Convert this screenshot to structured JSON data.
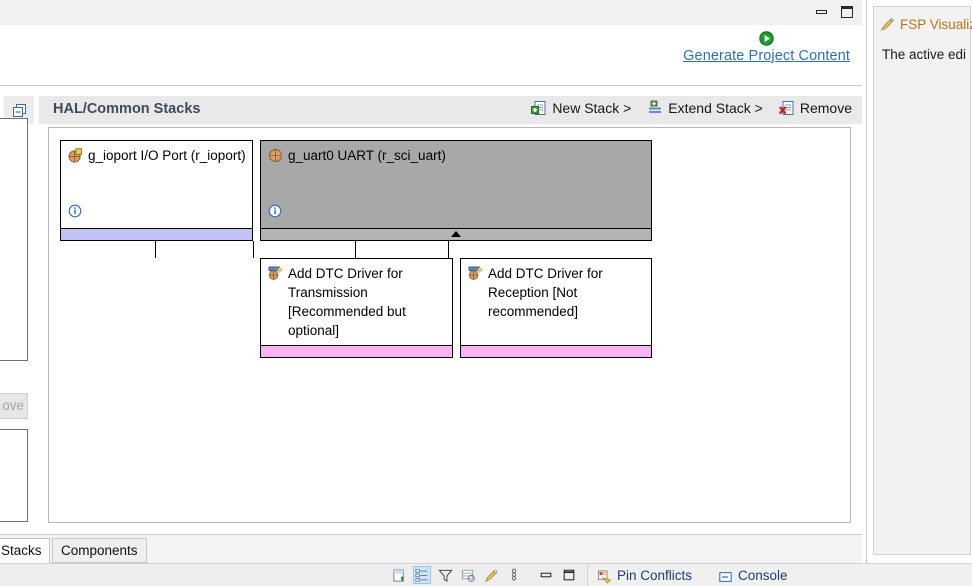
{
  "editor": {
    "window_controls": {
      "minimize": "minimize",
      "maximize": "maximize"
    },
    "generate": {
      "link_label": "Generate Project Content",
      "icon": "green-play-icon",
      "link_color": "#2f6fb8"
    },
    "section": {
      "title": "HAL/Common Stacks",
      "collapse_icon": "collapse-icon",
      "actions": [
        {
          "label": "New Stack >",
          "icon": "new-stack-icon"
        },
        {
          "label": "Extend Stack >",
          "icon": "extend-stack-icon"
        },
        {
          "label": "Remove",
          "icon": "remove-icon"
        }
      ]
    },
    "tabs": [
      {
        "label": "Stacks",
        "active": true
      },
      {
        "label": "Components",
        "active": false
      }
    ]
  },
  "diagram": {
    "nodes": [
      {
        "id": "ioport",
        "title": "g_ioport I/O Port (r_ioport)",
        "icon": "module-icon",
        "info_icon": "info-icon",
        "footer_color": "#c2c2f5",
        "selected": false
      },
      {
        "id": "uart",
        "title": "g_uart0 UART (r_sci_uart)",
        "icon": "module-icon",
        "info_icon": "info-icon",
        "footer_color": "#b4b4b4",
        "selected": true,
        "expander": "triangle-up-icon"
      },
      {
        "id": "dtc-tx",
        "title": "Add DTC Driver for Transmission [Recommended but optional]",
        "icon": "add-module-icon",
        "footer_color": "#f7b3f2",
        "selected": false
      },
      {
        "id": "dtc-rx",
        "title": "Add DTC Driver for Reception [Not recommended]",
        "icon": "add-module-icon",
        "footer_color": "#f7b3f2",
        "selected": false
      }
    ]
  },
  "left_peek": {
    "collapse_icon": "collapse-icon",
    "remove_button_label": "ove"
  },
  "right_panel": {
    "title": "FSP Visualiz",
    "title_color": "#b8751a",
    "icon": "pencil-icon",
    "body_text": "The active edi"
  },
  "bottom_strip": {
    "tool_icons": [
      "new-pin-config-icon",
      "tree-view-icon",
      "filter-icon",
      "table-view-icon",
      "marker-icon",
      "chain-icon"
    ],
    "window_controls": [
      "minimize",
      "maximize"
    ],
    "views": [
      {
        "label": "Pin Conflicts",
        "icon": "pin-conflicts-icon"
      },
      {
        "label": "Console",
        "icon": "console-icon"
      }
    ]
  }
}
